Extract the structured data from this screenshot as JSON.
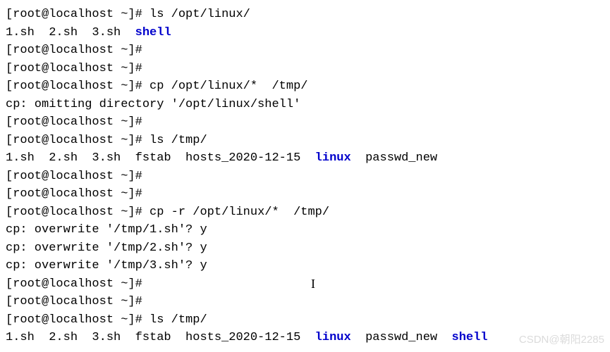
{
  "prompt": "[root@localhost ~]#",
  "commands": {
    "ls_opt": "ls /opt/linux/",
    "cp_flat": "cp /opt/linux/*  /tmp/",
    "ls_tmp": "ls /tmp/",
    "cp_r": "cp -r /opt/linux/*  /tmp/"
  },
  "output": {
    "ls_opt_files": "1.sh  2.sh  3.sh  ",
    "ls_opt_dir": "shell",
    "cp_omit": "cp: omitting directory '/opt/linux/shell'",
    "ls_tmp_pre": "1.sh  2.sh  3.sh  fstab  hosts_2020-12-15  ",
    "ls_tmp_dir": "linux",
    "ls_tmp_post": "  passwd_new",
    "ow1": "cp: overwrite '/tmp/1.sh'? y",
    "ow2": "cp: overwrite '/tmp/2.sh'? y",
    "ow3": "cp: overwrite '/tmp/3.sh'? y",
    "ls_tmp2_pre": "1.sh  2.sh  3.sh  fstab  hosts_2020-12-15  ",
    "ls_tmp2_dir": "linux",
    "ls_tmp2_post": "  passwd_new  ",
    "ls_tmp2_dir2": "shell"
  },
  "cursor": "I",
  "watermark": "CSDN@朝阳2285"
}
